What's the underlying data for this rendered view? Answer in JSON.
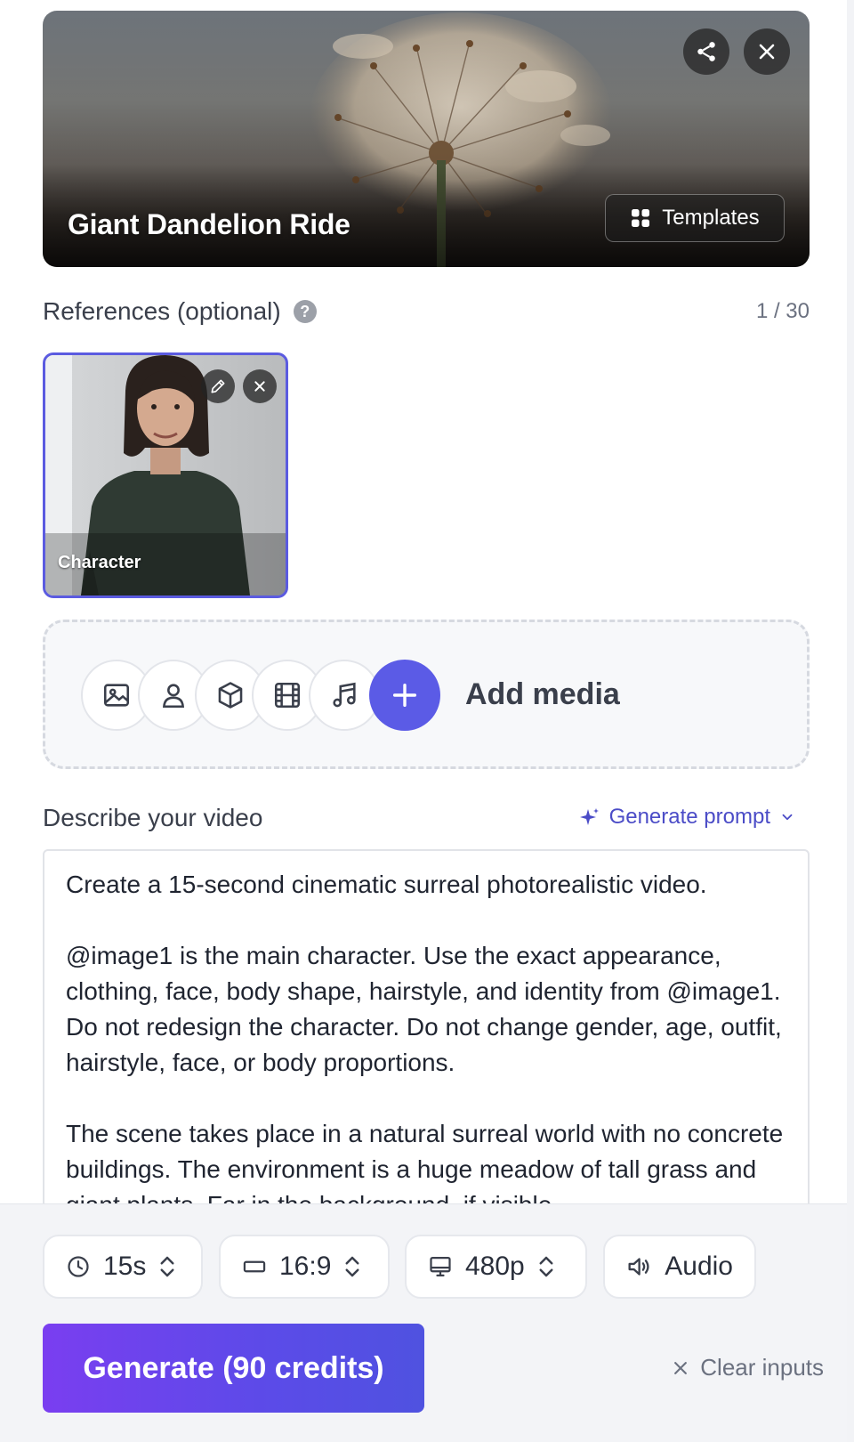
{
  "hero": {
    "title": "Giant Dandelion Ride",
    "templates_label": "Templates"
  },
  "references": {
    "label": "References (optional)",
    "help": "?",
    "count": "1 / 30",
    "items": [
      {
        "label": "Character"
      }
    ]
  },
  "add_media": {
    "label": "Add media",
    "types": [
      "image-icon",
      "person-icon",
      "cube-icon",
      "film-icon",
      "music-icon"
    ]
  },
  "prompt": {
    "label": "Describe your video",
    "generate_prompt_label": "Generate prompt",
    "paragraphs": [
      "Create a 15-second cinematic surreal photorealistic video.",
      "@image1 is the main character. Use the exact appearance, clothing, face, body shape, hairstyle, and identity from @image1. Do not redesign the character. Do not change gender, age, outfit, hairstyle, face, or body proportions.",
      "The scene takes place in a natural surreal world with no concrete buildings. The environment is a huge meadow of tall grass and giant plants. Far in the background, if visible"
    ]
  },
  "controls": {
    "duration": "15s",
    "aspect_ratio": "16:9",
    "resolution": "480p",
    "audio": "Audio"
  },
  "actions": {
    "generate": "Generate (90 credits)",
    "clear": "Clear inputs"
  },
  "colors": {
    "accent": "#5b5be6",
    "accent_text": "#4b4cc7",
    "generate_gradient_start": "#7a3ef0",
    "generate_gradient_end": "#4f52e0"
  }
}
